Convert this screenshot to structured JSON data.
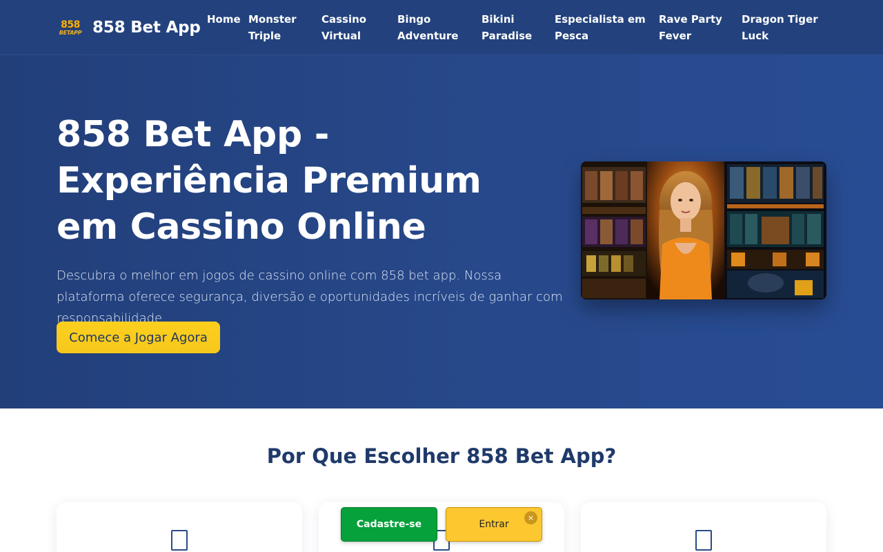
{
  "header": {
    "logo_top": "858",
    "logo_bottom": "BETAPP",
    "brand": "858 Bet App",
    "nav": [
      {
        "line1": "Home",
        "line2": ""
      },
      {
        "line1": "Monster",
        "line2": "Triple"
      },
      {
        "line1": "Cassino",
        "line2": "Virtual"
      },
      {
        "line1": "Bingo",
        "line2": "Adventure"
      },
      {
        "line1": "Bikini",
        "line2": "Paradise"
      },
      {
        "line1": "Especialista em",
        "line2": "Pesca"
      },
      {
        "line1": "Rave Party",
        "line2": "Fever"
      },
      {
        "line1": "Dragon Tiger",
        "line2": "Luck"
      }
    ]
  },
  "hero": {
    "title": "858 Bet App - Experiência Premium em Cassino Online",
    "description": "Descubra o melhor em jogos de cassino online com 858 bet app. Nossa plataforma oferece segurança, diversão e oportunidades incríveis de ganhar com responsabilidade.",
    "cta_label": "Comece a Jogar Agora"
  },
  "features": {
    "title": "Por Que Escolher 858 Bet App?"
  },
  "floating": {
    "signup_label": "Cadastre-se",
    "login_label": "Entrar",
    "close_label": "×"
  },
  "colors": {
    "header_bg": "#23427d",
    "hero_bg": "#27488a",
    "accent_yellow": "#fccf1e",
    "signup_green": "#06a13b",
    "heading_navy": "#1f3a6a"
  }
}
